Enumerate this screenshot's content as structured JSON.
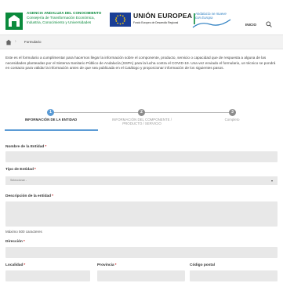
{
  "header": {
    "org_name": "AGENCIA ANDALUZA DEL CONOCIMIENTO",
    "org_dept": "Consejería de Transformación Económica, Industria, Conocimiento y Universidades",
    "eu_title": "UNIÓN EUROPEA",
    "eu_subtitle": "Fondo Europeo de Desarrollo Regional",
    "andalucia_text": "Andalucía se mueve con Europa",
    "nav_home": "INICIO",
    "brand_green": "#0a8a3c",
    "eu_blue": "#1a3e96"
  },
  "breadcrumb": {
    "current": "Formulario"
  },
  "intro": "Este es el formulario a cumplimentar para hacernos llegar la información sobre el componente, producto, servicio o capacidad que de respuesta a alguna de las necesidades planteadas por el Sistema Sanitario Público de Andalucía (SSPA) para la lucha contra el COVID-19. Una vez enviado el formulario, un técnico se pondrá en contacto para validar la información antes de que sea publicada en el Catálogo y proporcionar información de los siguientes pasos.",
  "stepper": {
    "accent": "#5b9bd5",
    "steps": [
      {
        "number": "1",
        "label": "INFORMACIÓN DE LA ENTIDAD",
        "active": true
      },
      {
        "number": "2",
        "label": "INFORMACIÓN DEL COMPONENTE / PRODUCTO / SERVICIO",
        "active": false
      },
      {
        "number": "3",
        "label": "Completo",
        "active": false
      }
    ]
  },
  "form": {
    "required_mark": "*",
    "entity_name_label": "Nombre de la Entidad",
    "entity_type_label": "Tipo de Entidad",
    "entity_type_value": "Seleccionar -",
    "description_label": "Descripción de la entidad",
    "description_help": "Máximo 500 caracteres",
    "address_label": "Dirección",
    "city_label": "Localidad",
    "province_label": "Provincia",
    "postal_label": "Código postal"
  }
}
